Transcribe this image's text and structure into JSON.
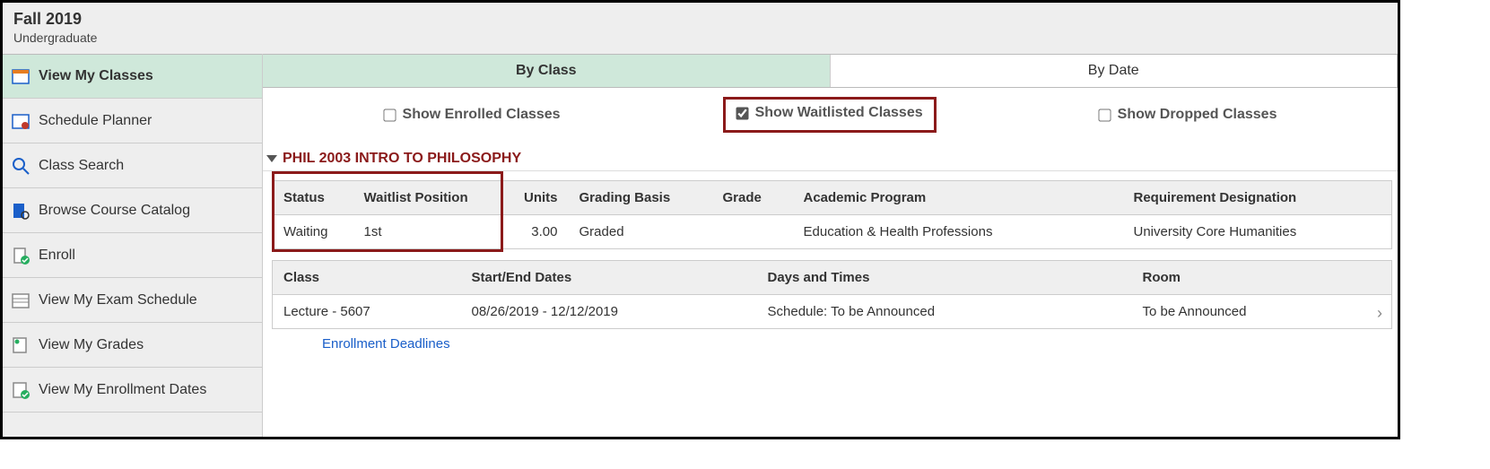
{
  "header": {
    "term": "Fall 2019",
    "level": "Undergraduate"
  },
  "sidebar": {
    "items": [
      {
        "label": "View My Classes"
      },
      {
        "label": "Schedule Planner"
      },
      {
        "label": "Class Search"
      },
      {
        "label": "Browse Course Catalog"
      },
      {
        "label": "Enroll"
      },
      {
        "label": "View My Exam Schedule"
      },
      {
        "label": "View My Grades"
      },
      {
        "label": "View My Enrollment Dates"
      }
    ]
  },
  "tabs": {
    "by_class": "By Class",
    "by_date": "By Date"
  },
  "filters": {
    "enrolled": "Show Enrolled Classes",
    "waitlisted": "Show Waitlisted Classes",
    "dropped": "Show Dropped Classes"
  },
  "course": {
    "title": "PHIL 2003 INTRO TO PHILOSOPHY"
  },
  "table1": {
    "headers": {
      "status": "Status",
      "waitlist": "Waitlist Position",
      "units": "Units",
      "grading": "Grading Basis",
      "grade": "Grade",
      "program": "Academic Program",
      "reqdes": "Requirement Designation"
    },
    "row": {
      "status": "Waiting",
      "waitlist": "1st",
      "units": "3.00",
      "grading": "Graded",
      "grade": "",
      "program": "Education & Health Professions",
      "reqdes": "University Core Humanities"
    }
  },
  "table2": {
    "headers": {
      "class": "Class",
      "dates": "Start/End Dates",
      "days": "Days and Times",
      "room": "Room"
    },
    "row": {
      "class": "Lecture - 5607",
      "dates": "08/26/2019 - 12/12/2019",
      "days": "Schedule: To be Announced",
      "room": "To be Announced"
    }
  },
  "links": {
    "deadlines": "Enrollment Deadlines"
  }
}
